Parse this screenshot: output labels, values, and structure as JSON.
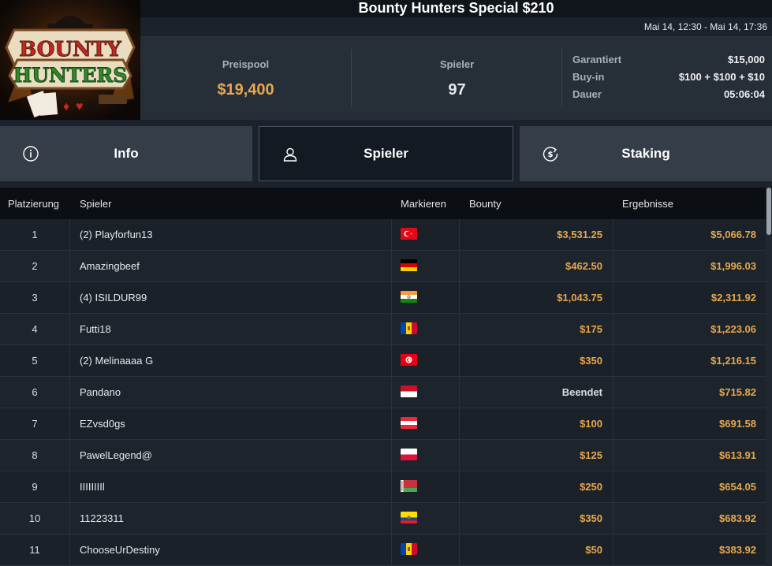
{
  "tournament": {
    "title": "Bounty Hunters Special $210",
    "dates": "Mai 14, 12:30 - Mai 14, 17:36",
    "logo_text_top": "BOUNTY",
    "logo_text_bottom": "HUNTERS"
  },
  "stats": {
    "prizepool_label": "Preispool",
    "prizepool_value": "$19,400",
    "players_label": "Spieler",
    "players_value": "97",
    "guaranteed_label": "Garantiert",
    "guaranteed_value": "$15,000",
    "buyin_label": "Buy-in",
    "buyin_value": "$100 + $100 + $10",
    "duration_label": "Dauer",
    "duration_value": "05:06:04"
  },
  "tabs": [
    {
      "label": "Info",
      "icon": "info-icon",
      "active": false
    },
    {
      "label": "Spieler",
      "icon": "user-icon",
      "active": true
    },
    {
      "label": "Staking",
      "icon": "dollar-coin-icon",
      "active": false
    }
  ],
  "table": {
    "headers": {
      "rank": "Platzierung",
      "player": "Spieler",
      "flag": "Markieren",
      "bounty": "Bounty",
      "result": "Ergebnisse"
    },
    "rows": [
      {
        "rank": "1",
        "player": "(2) Playforfun13",
        "flag": "turkey",
        "bounty": "$3,531.25",
        "result": "$5,066.78"
      },
      {
        "rank": "2",
        "player": "Amazingbeef",
        "flag": "germany",
        "bounty": "$462.50",
        "result": "$1,996.03"
      },
      {
        "rank": "3",
        "player": "(4) ISILDUR99",
        "flag": "india",
        "bounty": "$1,043.75",
        "result": "$2,311.92"
      },
      {
        "rank": "4",
        "player": "Futti18",
        "flag": "moldova",
        "bounty": "$175",
        "result": "$1,223.06"
      },
      {
        "rank": "5",
        "player": "(2) Melinaaaa G",
        "flag": "tunisia",
        "bounty": "$350",
        "result": "$1,216.15"
      },
      {
        "rank": "6",
        "player": "Pandano",
        "flag": "monaco",
        "bounty": "Beendet",
        "result": "$715.82"
      },
      {
        "rank": "7",
        "player": "EZvsd0gs",
        "flag": "austria",
        "bounty": "$100",
        "result": "$691.58"
      },
      {
        "rank": "8",
        "player": "PawelLegend@",
        "flag": "poland",
        "bounty": "$125",
        "result": "$613.91"
      },
      {
        "rank": "9",
        "player": "IIIIIIIIl",
        "flag": "belarus",
        "bounty": "$250",
        "result": "$654.05"
      },
      {
        "rank": "10",
        "player": "11223311",
        "flag": "ecuador",
        "bounty": "$350",
        "result": "$683.92"
      },
      {
        "rank": "11",
        "player": "ChooseUrDestiny",
        "flag": "moldova",
        "bounty": "$50",
        "result": "$383.92"
      }
    ]
  },
  "colors": {
    "accent": "#e7a74e",
    "background": "#1b222b",
    "header_panel": "#262e38"
  }
}
